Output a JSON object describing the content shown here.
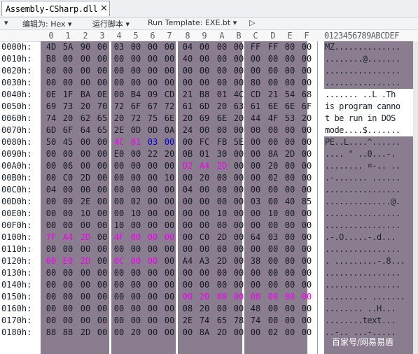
{
  "tab": {
    "title": "Assembly-CSharp.dll",
    "close": "✕"
  },
  "toolbar": {
    "menu_arrow": "▾",
    "edit_as": "编辑为: Hex ▾",
    "run_script": "运行脚本 ▾",
    "run_template": "Run Template: EXE.bt ▾",
    "play": "▷"
  },
  "columns": [
    "0",
    "1",
    "2",
    "3",
    "4",
    "5",
    "6",
    "7",
    "8",
    "9",
    "A",
    "B",
    "C",
    "D",
    "E",
    "F"
  ],
  "ascii_header": "0123456789ABCDEF",
  "colors": {
    "magenta": "#ee00ee",
    "blue": "#0000cc",
    "bg": "#8b7d90"
  },
  "rows": [
    {
      "offset": "0000h:",
      "bytes": [
        "4D",
        "5A",
        "90",
        "00",
        "03",
        "00",
        "00",
        "00",
        "04",
        "00",
        "00",
        "00",
        "FF",
        "FF",
        "00",
        "00"
      ],
      "ascii": "MZ.............."
    },
    {
      "offset": "0010h:",
      "bytes": [
        "B8",
        "00",
        "00",
        "00",
        "00",
        "00",
        "00",
        "00",
        "40",
        "00",
        "00",
        "00",
        "00",
        "00",
        "00",
        "00"
      ],
      "ascii": "........@......."
    },
    {
      "offset": "0020h:",
      "bytes": [
        "00",
        "00",
        "00",
        "00",
        "00",
        "00",
        "00",
        "00",
        "00",
        "00",
        "00",
        "00",
        "00",
        "00",
        "00",
        "00"
      ],
      "ascii": "................"
    },
    {
      "offset": "0030h:",
      "bytes": [
        "00",
        "00",
        "00",
        "00",
        "00",
        "00",
        "00",
        "00",
        "00",
        "00",
        "00",
        "00",
        "80",
        "00",
        "00",
        "00"
      ],
      "ascii": "................"
    },
    {
      "offset": "0040h:",
      "bytes": [
        "0E",
        "1F",
        "BA",
        "0E",
        "00",
        "B4",
        "09",
        "CD",
        "21",
        "B8",
        "01",
        "4C",
        "CD",
        "21",
        "54",
        "68"
      ],
      "ascii": "....... ..L .Th"
    },
    {
      "offset": "0050h:",
      "bytes": [
        "69",
        "73",
        "20",
        "70",
        "72",
        "6F",
        "67",
        "72",
        "61",
        "6D",
        "20",
        "63",
        "61",
        "6E",
        "6E",
        "6F"
      ],
      "ascii": "is program canno"
    },
    {
      "offset": "0060h:",
      "bytes": [
        "74",
        "20",
        "62",
        "65",
        "20",
        "72",
        "75",
        "6E",
        "20",
        "69",
        "6E",
        "20",
        "44",
        "4F",
        "53",
        "20"
      ],
      "ascii": "t be run in DOS "
    },
    {
      "offset": "0070h:",
      "bytes": [
        "6D",
        "6F",
        "64",
        "65",
        "2E",
        "0D",
        "0D",
        "0A",
        "24",
        "00",
        "00",
        "00",
        "00",
        "00",
        "00",
        "00"
      ],
      "ascii": "mode....$......."
    },
    {
      "offset": "0080h:",
      "bytes": [
        "50",
        "45",
        "00",
        "00",
        "4C",
        "01",
        "03",
        "00",
        "00",
        "FC",
        "FB",
        "5E",
        "00",
        "00",
        "00",
        "00"
      ],
      "ascii": "PE..L....^......"
    },
    {
      "offset": "0090h:",
      "bytes": [
        "00",
        "00",
        "00",
        "00",
        "E0",
        "00",
        "22",
        "20",
        "0B",
        "01",
        "30",
        "00",
        "00",
        "8A",
        "2D",
        "00"
      ],
      "ascii": ".... \" ..0...-."
    },
    {
      "offset": "00A0h:",
      "bytes": [
        "00",
        "06",
        "00",
        "00",
        "00",
        "00",
        "00",
        "00",
        "D2",
        "A4",
        "2D",
        "00",
        "00",
        "20",
        "00",
        "00"
      ],
      "ascii": "........ ¤-.. .."
    },
    {
      "offset": "00B0h:",
      "bytes": [
        "00",
        "C0",
        "2D",
        "00",
        "00",
        "00",
        "00",
        "10",
        "00",
        "20",
        "00",
        "00",
        "00",
        "02",
        "00",
        "00"
      ],
      "ascii": ".-....... ......"
    },
    {
      "offset": "00C0h:",
      "bytes": [
        "04",
        "00",
        "00",
        "00",
        "00",
        "00",
        "00",
        "00",
        "04",
        "00",
        "00",
        "00",
        "00",
        "00",
        "00",
        "00"
      ],
      "ascii": "................"
    },
    {
      "offset": "00D0h:",
      "bytes": [
        "00",
        "00",
        "2E",
        "00",
        "00",
        "02",
        "00",
        "00",
        "00",
        "00",
        "00",
        "00",
        "03",
        "00",
        "40",
        "85"
      ],
      "ascii": "..............@."
    },
    {
      "offset": "00E0h:",
      "bytes": [
        "00",
        "00",
        "10",
        "00",
        "00",
        "10",
        "00",
        "00",
        "00",
        "00",
        "10",
        "00",
        "00",
        "10",
        "00",
        "00"
      ],
      "ascii": "................"
    },
    {
      "offset": "00F0h:",
      "bytes": [
        "00",
        "00",
        "00",
        "00",
        "10",
        "00",
        "00",
        "00",
        "00",
        "00",
        "00",
        "00",
        "00",
        "00",
        "00",
        "00"
      ],
      "ascii": "................"
    },
    {
      "offset": "0100h:",
      "bytes": [
        "7F",
        "A4",
        "2D",
        "00",
        "4F",
        "00",
        "00",
        "00",
        "00",
        "C0",
        "2D",
        "00",
        "64",
        "03",
        "00",
        "00"
      ],
      "ascii": ".-.O.....-.d..."
    },
    {
      "offset": "0110h:",
      "bytes": [
        "00",
        "00",
        "00",
        "00",
        "00",
        "00",
        "00",
        "00",
        "00",
        "00",
        "00",
        "00",
        "00",
        "00",
        "00",
        "00"
      ],
      "ascii": "................"
    },
    {
      "offset": "0120h:",
      "bytes": [
        "00",
        "E0",
        "2D",
        "00",
        "0C",
        "00",
        "00",
        "00",
        "A4",
        "A3",
        "2D",
        "00",
        "38",
        "00",
        "00",
        "00"
      ],
      "ascii": ". .........-.8..."
    },
    {
      "offset": "0130h:",
      "bytes": [
        "00",
        "00",
        "00",
        "00",
        "00",
        "00",
        "00",
        "00",
        "00",
        "00",
        "00",
        "00",
        "00",
        "00",
        "00",
        "00"
      ],
      "ascii": "................"
    },
    {
      "offset": "0140h:",
      "bytes": [
        "00",
        "00",
        "00",
        "00",
        "00",
        "00",
        "00",
        "00",
        "00",
        "00",
        "00",
        "00",
        "00",
        "00",
        "00",
        "00"
      ],
      "ascii": "................"
    },
    {
      "offset": "0150h:",
      "bytes": [
        "00",
        "00",
        "00",
        "00",
        "00",
        "00",
        "00",
        "00",
        "00",
        "20",
        "00",
        "00",
        "08",
        "00",
        "00",
        "00"
      ],
      "ascii": "......... ......."
    },
    {
      "offset": "0160h:",
      "bytes": [
        "00",
        "00",
        "00",
        "00",
        "00",
        "00",
        "00",
        "00",
        "08",
        "20",
        "00",
        "00",
        "48",
        "00",
        "00",
        "00"
      ],
      "ascii": "........ ..H..."
    },
    {
      "offset": "0170h:",
      "bytes": [
        "00",
        "00",
        "00",
        "00",
        "00",
        "00",
        "00",
        "00",
        "2E",
        "74",
        "65",
        "78",
        "74",
        "00",
        "00",
        "00"
      ],
      "ascii": "........text..."
    },
    {
      "offset": "0180h:",
      "bytes": [
        "88",
        "88",
        "2D",
        "00",
        "00",
        "20",
        "00",
        "00",
        "00",
        "8A",
        "2D",
        "00",
        "00",
        "02",
        "00",
        "00"
      ],
      "ascii": "..-.. ...-....."
    }
  ],
  "watermark": "百家号/网易易盾"
}
